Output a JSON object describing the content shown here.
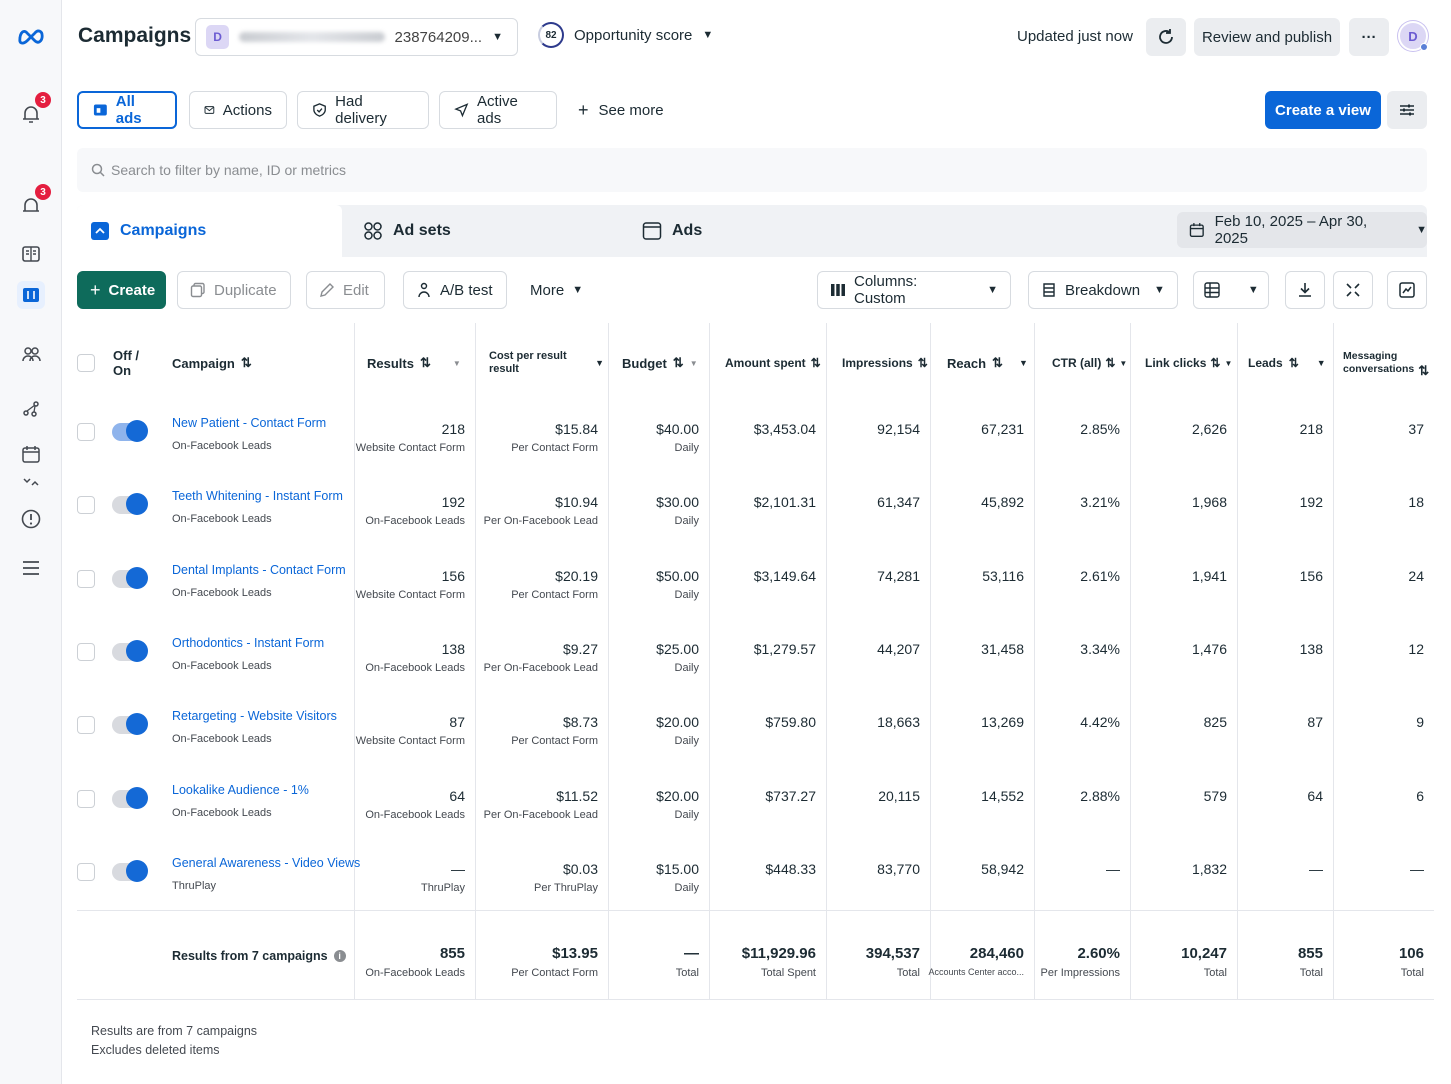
{
  "header": {
    "title": "Campaigns",
    "account_initial": "D",
    "account_number": "238764209...",
    "opportunity_score": "82",
    "opportunity_label": "Opportunity score",
    "updated": "Updated just now",
    "review_publish": "Review and publish",
    "more": "···",
    "user_initial": "D"
  },
  "rail": {
    "badge1": "3",
    "badge2": "3"
  },
  "filters": {
    "all_ads": "All ads",
    "actions": "Actions",
    "had_delivery": "Had delivery",
    "active_ads": "Active ads",
    "see_more": "See more",
    "create_view": "Create a view"
  },
  "search": {
    "placeholder": "Search to filter by name, ID or metrics"
  },
  "tabs": {
    "campaigns": "Campaigns",
    "ad_sets": "Ad sets",
    "ads": "Ads",
    "date_range": "Feb 10, 2025 – Apr 30, 2025"
  },
  "toolbar": {
    "create": "Create",
    "duplicate": "Duplicate",
    "edit": "Edit",
    "ab_test": "A/B test",
    "more": "More",
    "columns": "Columns: Custom",
    "breakdown": "Breakdown"
  },
  "columns": {
    "off_on_1": "Off /",
    "off_on_2": "On",
    "campaign": "Campaign",
    "results": "Results",
    "cpr_1": "Cost per result",
    "cpr_2": "result",
    "budget": "Budget",
    "amount_spent": "Amount spent",
    "impressions": "Impressions",
    "reach": "Reach",
    "ctr": "CTR (all)",
    "link_clicks": "Link clicks",
    "leads": "Leads",
    "msg_1": "Messaging",
    "msg_2": "conversations",
    "sort_glyph": "⇅"
  },
  "rows": [
    {
      "name": "New Patient - Contact Form",
      "type": "On-Facebook Leads",
      "results": "218",
      "results_sub": "Website Contact Form",
      "cpr": "$15.84",
      "cpr_sub": "Per Contact Form",
      "budget": "$40.00",
      "budget_sub": "Daily",
      "spent": "$3,453.04",
      "impr": "92,154",
      "reach": "67,231",
      "ctr": "2.85%",
      "clicks": "2,626",
      "leads": "218",
      "msgs": "37",
      "on": "active"
    },
    {
      "name": "Teeth Whitening - Instant Form",
      "type": "On-Facebook Leads",
      "results": "192",
      "results_sub": "On-Facebook Leads",
      "cpr": "$10.94",
      "cpr_sub": "Per On-Facebook Lead",
      "budget": "$30.00",
      "budget_sub": "Daily",
      "spent": "$2,101.31",
      "impr": "61,347",
      "reach": "45,892",
      "ctr": "3.21%",
      "clicks": "1,968",
      "leads": "192",
      "msgs": "18",
      "on": "inactive"
    },
    {
      "name": "Dental Implants - Contact Form",
      "type": "On-Facebook Leads",
      "results": "156",
      "results_sub": "Website Contact Form",
      "cpr": "$20.19",
      "cpr_sub": "Per Contact Form",
      "budget": "$50.00",
      "budget_sub": "Daily",
      "spent": "$3,149.64",
      "impr": "74,281",
      "reach": "53,116",
      "ctr": "2.61%",
      "clicks": "1,941",
      "leads": "156",
      "msgs": "24",
      "on": "inactive"
    },
    {
      "name": "Orthodontics - Instant Form",
      "type": "On-Facebook Leads",
      "results": "138",
      "results_sub": "On-Facebook Leads",
      "cpr": "$9.27",
      "cpr_sub": "Per On-Facebook Lead",
      "budget": "$25.00",
      "budget_sub": "Daily",
      "spent": "$1,279.57",
      "impr": "44,207",
      "reach": "31,458",
      "ctr": "3.34%",
      "clicks": "1,476",
      "leads": "138",
      "msgs": "12",
      "on": "inactive"
    },
    {
      "name": "Retargeting - Website Visitors",
      "type": "On-Facebook Leads",
      "results": "87",
      "results_sub": "Website Contact Form",
      "cpr": "$8.73",
      "cpr_sub": "Per Contact Form",
      "budget": "$20.00",
      "budget_sub": "Daily",
      "spent": "$759.80",
      "impr": "18,663",
      "reach": "13,269",
      "ctr": "4.42%",
      "clicks": "825",
      "leads": "87",
      "msgs": "9",
      "on": "inactive"
    },
    {
      "name": "Lookalike Audience - 1%",
      "type": "On-Facebook Leads",
      "results": "64",
      "results_sub": "On-Facebook Leads",
      "cpr": "$11.52",
      "cpr_sub": "Per On-Facebook Lead",
      "budget": "$20.00",
      "budget_sub": "Daily",
      "spent": "$737.27",
      "impr": "20,115",
      "reach": "14,552",
      "ctr": "2.88%",
      "clicks": "579",
      "leads": "64",
      "msgs": "6",
      "on": "inactive"
    },
    {
      "name": "General Awareness - Video Views",
      "type": "ThruPlay",
      "results": "—",
      "results_sub": "ThruPlay",
      "cpr": "$0.03",
      "cpr_sub": "Per ThruPlay",
      "budget": "$15.00",
      "budget_sub": "Daily",
      "spent": "$448.33",
      "impr": "83,770",
      "reach": "58,942",
      "ctr": "—",
      "clicks": "1,832",
      "leads": "—",
      "msgs": "—",
      "on": "inactive"
    }
  ],
  "totals": {
    "label": "Results from 7 campaigns",
    "results": "855",
    "results_sub": "On-Facebook Leads",
    "cpr": "$13.95",
    "cpr_sub": "Per Contact Form",
    "budget": "—",
    "budget_sub": "Total",
    "spent": "$11,929.96",
    "spent_sub": "Total Spent",
    "impr": "394,537",
    "impr_sub": "Total",
    "reach": "284,460",
    "reach_sub": "Accounts Center acco...",
    "ctr": "2.60%",
    "ctr_sub": "Per Impressions",
    "clicks": "10,247",
    "clicks_sub": "Total",
    "leads": "855",
    "leads_sub": "Total",
    "msgs": "106",
    "msgs_sub": "Total"
  },
  "footer": {
    "line1": "Results are from 7 campaigns",
    "line2": "Excludes deleted items"
  },
  "colors": {
    "accent": "#0a66d8",
    "create_green": "#0e6b5b",
    "toggle_on": "#1469d6",
    "badge_red": "#e41e3f"
  }
}
